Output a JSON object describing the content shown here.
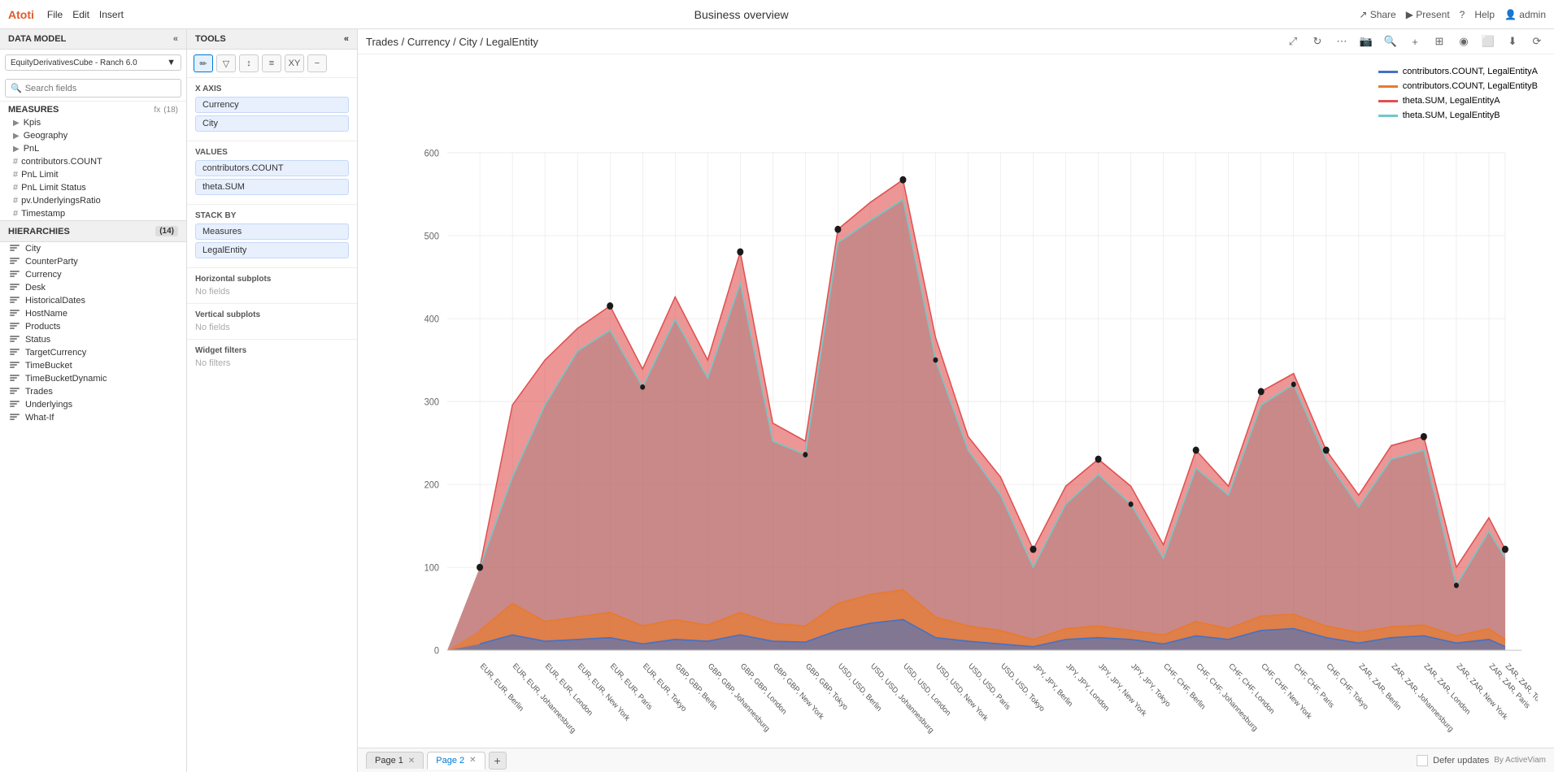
{
  "app": {
    "name": "Atoti",
    "title": "Business overview"
  },
  "topbar": {
    "menu": [
      "File",
      "Edit",
      "Insert"
    ],
    "right_actions": [
      "Share",
      "Present",
      "?",
      "Help",
      "admin"
    ]
  },
  "left_panel": {
    "data_model_label": "DATA MODEL",
    "model_selector": "EquityDerivativesCube - Ranch 6.0",
    "search_placeholder": "Search fields",
    "measures_label": "MEASURES",
    "measures_count": "(18)",
    "measures_items": [
      {
        "icon": "folder",
        "label": "Kpis"
      },
      {
        "icon": "folder",
        "label": "Geography"
      },
      {
        "icon": "folder",
        "label": "PnL"
      },
      {
        "icon": "hash",
        "label": "contributors.COUNT"
      },
      {
        "icon": "hash",
        "label": "PnL Limit"
      },
      {
        "icon": "hash",
        "label": "PnL Limit Status"
      },
      {
        "icon": "hash",
        "label": "pv.UnderlyingsRatio"
      },
      {
        "icon": "hash",
        "label": "Timestamp"
      }
    ],
    "hierarchies_label": "HIERARCHIES",
    "hierarchies_count": "(14)",
    "hierarchies_items": [
      "City",
      "CounterParty",
      "Currency",
      "Desk",
      "HistoricalDates",
      "HostName",
      "Products",
      "Status",
      "TargetCurrency",
      "TimeBucket",
      "TimeBucketDynamic",
      "Trades",
      "Underlyings",
      "What-If"
    ]
  },
  "tools_panel": {
    "label": "TOOLS",
    "toolbar_buttons": [
      "pencil",
      "filter",
      "funnel",
      "sort",
      "table",
      "xy",
      "minus"
    ],
    "x_axis_label": "X axis",
    "x_axis_items": [
      "Currency",
      "City"
    ],
    "values_label": "Values",
    "values_items": [
      "contributors.COUNT",
      "theta.SUM"
    ],
    "stack_by_label": "Stack by",
    "stack_items": [
      "Measures",
      "LegalEntity"
    ],
    "h_subplots_label": "Horizontal subplots",
    "h_subplots_no_fields": "No fields",
    "v_subplots_label": "Vertical subplots",
    "v_subplots_no_fields": "No fields",
    "widget_filters_label": "Widget filters",
    "widget_filters_no_filters": "No filters"
  },
  "chart": {
    "breadcrumb": "Trades / Currency / City / LegalEntity",
    "y_axis_values": [
      0,
      100,
      200,
      300,
      400,
      500,
      600
    ],
    "legend": [
      {
        "label": "contributors.COUNT, LegalEntityA",
        "color": "#4472c4",
        "type": "line"
      },
      {
        "label": "contributors.COUNT, LegalEntityB",
        "color": "#e87a2e",
        "type": "line"
      },
      {
        "label": "theta.SUM, LegalEntityA",
        "color": "#e05050",
        "type": "area"
      },
      {
        "label": "theta.SUM, LegalEntityB",
        "color": "#70c8c8",
        "type": "area"
      }
    ],
    "x_labels": [
      "EUR, EUR, Berlin",
      "EUR, EUR, Johannesburg",
      "EUR, EUR, London",
      "EUR, EUR, New York",
      "EUR, EUR, Paris",
      "EUR, EUR, Tokyo",
      "GBP, GBP, Berlin",
      "GBP, GBP, Johannesburg",
      "GBP, GBP, London",
      "GBP, GBP, New York",
      "GBP, GBP, Tokyo",
      "USD, USD, Berlin",
      "USD, USD, Johannesburg",
      "USD, USD, London",
      "USD, USD, New York",
      "USD, USD, Paris",
      "USD, USD, Tokyo",
      "JPY, JPY, Berlin",
      "JPY, JPY, London",
      "JPY, JPY, New York",
      "JPY, JPY, Tokyo",
      "CHF, CHF, Berlin",
      "CHF, CHF, Johannesburg",
      "CHF, CHF, London",
      "CHF, CHF, New York",
      "CHF, CHF, Paris",
      "CHF, CHF, Tokyo",
      "ZAR, ZAR, Berlin",
      "ZAR, ZAR, Johannesburg",
      "ZAR, ZAR, London",
      "ZAR, ZAR, New York",
      "ZAR, ZAR, Paris",
      "ZAR, ZAR, Tokyo"
    ]
  },
  "bottom_bar": {
    "tabs": [
      {
        "label": "Page 1",
        "has_close": true,
        "active": false
      },
      {
        "label": "Page 2",
        "has_close": true,
        "active": true
      }
    ],
    "add_tab_label": "+",
    "defer_updates_label": "Defer updates",
    "by_active_label": "By ActiveViam"
  }
}
